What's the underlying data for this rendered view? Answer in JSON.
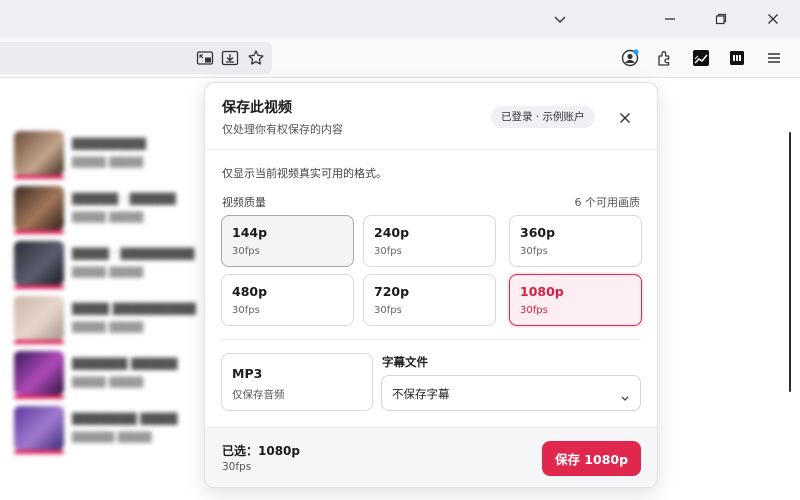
{
  "popup": {
    "title": "保存此视频",
    "subtitle": "仅处理你有权保存的内容",
    "account_badge": "已登录 · 示例账户",
    "note": "仅显示当前视频真实可用的格式。",
    "quality_label": "视频质量",
    "quality_count": "6 个可用画质",
    "qualities": [
      {
        "name": "144p",
        "fps": "30fps",
        "state": "hover"
      },
      {
        "name": "240p",
        "fps": "30fps",
        "state": "normal"
      },
      {
        "name": "360p",
        "fps": "30fps",
        "state": "normal"
      },
      {
        "name": "480p",
        "fps": "30fps",
        "state": "normal"
      },
      {
        "name": "720p",
        "fps": "30fps",
        "state": "normal"
      },
      {
        "name": "1080p",
        "fps": "30fps",
        "state": "selected"
      }
    ],
    "mp3": {
      "name": "MP3",
      "sub": "仅保存音频"
    },
    "subtitle_label": "字幕文件",
    "subtitle_select": "不保存字幕",
    "footer": {
      "selected": "已选：1080p",
      "fps": "30fps",
      "save_label": "保存 1080p"
    }
  },
  "colors": {
    "accent": "#e0284f",
    "selected_bg": "#fdeef1"
  },
  "icons": [
    "chevron-down-icon",
    "minimize-icon",
    "restore-icon",
    "close-icon",
    "picture-in-picture-icon",
    "download-icon",
    "bookmark-star-icon",
    "account-icon",
    "extensions-icon",
    "menu-icon"
  ]
}
